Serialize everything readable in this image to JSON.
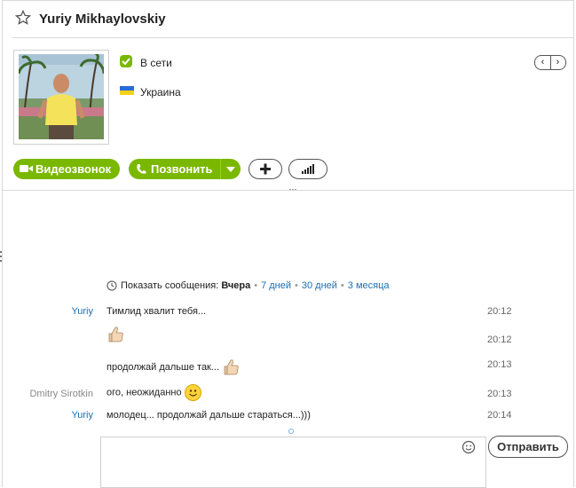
{
  "contact": {
    "name": "Yuriy Mikhaylovskiy",
    "status": "В сети",
    "country": "Украина"
  },
  "actions": {
    "video_label": "Видеозвонок",
    "call_label": "Позвонить"
  },
  "history": {
    "prefix": "Показать сообщения:",
    "selected": "Вчера",
    "options": [
      "7 дней",
      "30 дней",
      "3 месяца"
    ]
  },
  "messages": [
    {
      "author": "Yuriy",
      "text": "Тимлид хвалит тебя...",
      "time": "20:12"
    },
    {
      "author": "",
      "text": "",
      "time": "20:12",
      "emoticon": "thumbs-up"
    },
    {
      "author": "",
      "text": "продолжай дальше так...",
      "time": "20:13",
      "emoticon": "thumbs-up"
    },
    {
      "author": "Dmitry Sirotkin",
      "text": "ого, неожиданно",
      "time": "20:13",
      "emoticon": "smile"
    },
    {
      "author": "Yuriy",
      "text": "молодец... продолжай дальше стараться...)))",
      "time": "20:14"
    }
  ],
  "composer": {
    "send_label": "Отправить",
    "value": ""
  },
  "colors": {
    "accent_green": "#7ab800",
    "link_blue": "#1a6fb3",
    "author_blue": "#1a6fb3",
    "author_gray": "#888888"
  }
}
